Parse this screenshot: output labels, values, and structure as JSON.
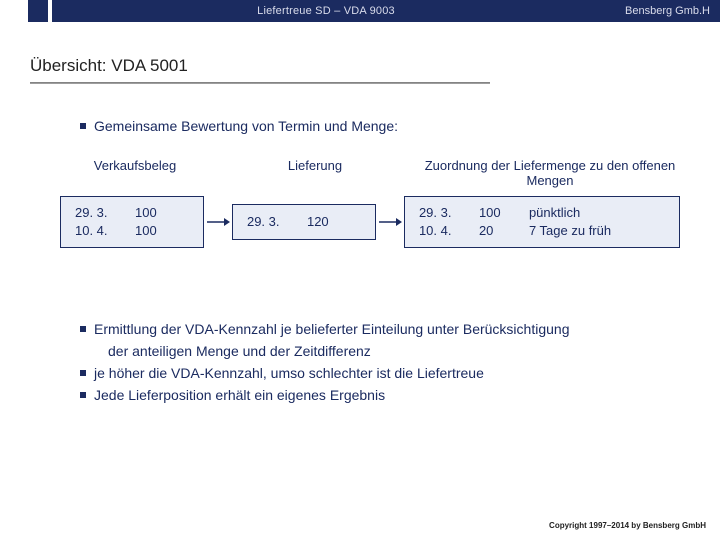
{
  "header": {
    "center": "Liefertreue SD – VDA 9003",
    "right": "Bensberg Gmb.H"
  },
  "title": "Übersicht: VDA 5001",
  "intro_bullet": "Gemeinsame Bewertung von Termin und Menge:",
  "labels": {
    "l1": "Verkaufsbeleg",
    "l2": "Lieferung",
    "l3": "Zuordnung der Liefermenge zu den offenen Mengen"
  },
  "box1": {
    "d1": "29. 3.",
    "d2": "10. 4.",
    "q1": "100",
    "q2": "100"
  },
  "box2": {
    "d": "29. 3.",
    "q": "120"
  },
  "box3": {
    "d1": "29. 3.",
    "d2": "10. 4.",
    "q1": "100",
    "q2": "20",
    "r1": "pünktlich",
    "r2": "7 Tage zu früh"
  },
  "bullets": {
    "b1a": "Ermittlung der VDA-Kennzahl je belieferter Einteilung unter Berücksichtigung",
    "b1b": "der anteiligen Menge und der Zeitdifferenz",
    "b2": "je höher die VDA-Kennzahl, umso schlechter ist die Liefertreue",
    "b3": "Jede Lieferposition erhält ein eigenes Ergebnis"
  },
  "copyright": "Copyright 1997–2014 by Bensberg GmbH"
}
